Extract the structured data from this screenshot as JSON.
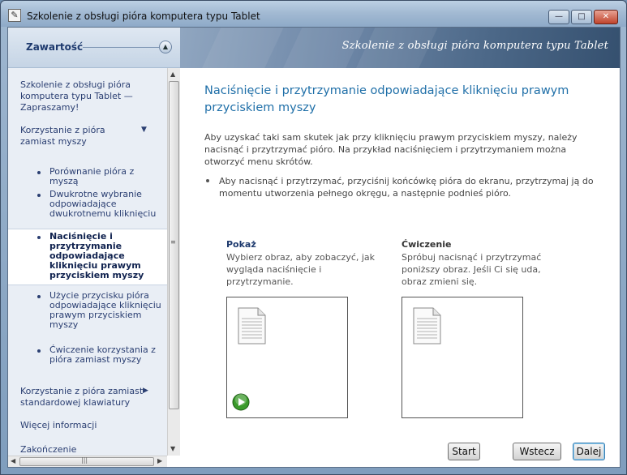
{
  "window": {
    "title": "Szkolenie z obsługi pióra komputera typu Tablet",
    "controls": {
      "minimize": "—",
      "maximize": "□",
      "close": "✕"
    }
  },
  "header": {
    "contents_label": "Zawartość",
    "banner_title": "Szkolenie z obsługi pióra komputera typu Tablet"
  },
  "sidebar": {
    "welcome": "Szkolenie z obsługi pióra komputera typu Tablet — Zapraszamy!",
    "section1": "Korzystanie z pióra zamiast myszy",
    "sub1": "Porównanie pióra z myszą",
    "sub2": "Dwukrotne wybranie odpowiadające dwukrotnemu kliknięciu",
    "sub3": "Naciśnięcie i przytrzymanie odpowiadające kliknięciu prawym przyciskiem myszy",
    "sub4": "Użycie przycisku pióra odpowiadające kliknięciu prawym przyciskiem myszy",
    "sub5": "Ćwiczenie korzystania z pióra zamiast myszy",
    "section2": "Korzystanie z pióra zamiast standardowej klawiatury",
    "more": "Więcej informacji",
    "ending": "Zakończenie"
  },
  "main": {
    "title": "Naciśnięcie i przytrzymanie odpowiadające kliknięciu prawym przyciskiem myszy",
    "intro": "Aby uzyskać taki sam skutek jak przy kliknięciu prawym przyciskiem myszy, należy nacisnąć i przytrzymać pióro. Na przykład naciśnięciem i przytrzymaniem można otworzyć menu skrótów.",
    "bullet": "Aby nacisnąć i przytrzymać, przyciśnij końcówkę pióra do ekranu, przytrzymaj ją do momentu utworzenia pełnego okręgu, a następnie podnieś pióro.",
    "show": {
      "heading": "Pokaż",
      "text": "Wybierz obraz, aby zobaczyć, jak wygląda naciśnięcie i przytrzymanie."
    },
    "practice": {
      "heading": "Ćwiczenie",
      "text": "Spróbuj nacisnąć i przytrzymać poniższy obraz. Jeśli Ci się uda, obraz zmieni się."
    }
  },
  "buttons": {
    "start": "Start",
    "back": "Wstecz",
    "next": "Dalej"
  },
  "icons": {
    "document": "document-icon",
    "play": "play-icon",
    "pen_app": "pen-app-icon"
  },
  "colors": {
    "title_blue": "#1f6fa8",
    "nav_text": "#2b3f72",
    "play_green": "#3a9a2a"
  }
}
